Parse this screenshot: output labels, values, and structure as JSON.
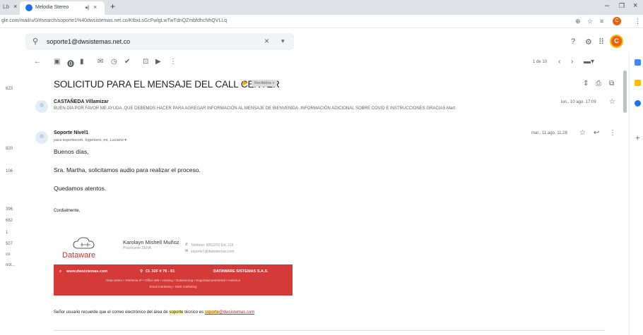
{
  "browser": {
    "prev_tab_fragment": "Lb",
    "tab_title": "Melodia Stereo",
    "url_prefix": "gle.com/mail/u/0/#search/soporte1%40dwsistemas.net.co/KtbxLsGcFwlgLwTwTdnQZmbfdhcNhQVLLq",
    "profile_letter": "C"
  },
  "gmail": {
    "search_value": "soporte1@dwsistemas.net.co",
    "avatar_letter": "C",
    "pager": "1 de 10",
    "left_counts": [
      "623",
      "820",
      "106",
      "396",
      "682",
      "1",
      "507",
      "co",
      "not..."
    ]
  },
  "thread": {
    "subject": "SOLICITUD PARA EL MENSAJE DEL CALL CENTER",
    "label": "Recibidos x",
    "messages": [
      {
        "sender": "CASTAÑEDA Villamizar",
        "snippet": "BUEN DIA POR FAVOR ME AYUDA .QUE DEBEMOS HACER PARA AGREGAR INFORMACIÓN AL MENSAJE DE BIENVENIDA .INFORMACIÓN ADICIONAL SOBRE COVID E INSTRUCCIONES GRACIAS Mart",
        "date": "lun., 10 ago. 17:09"
      },
      {
        "sender": "Soporte Nivel1",
        "recipients": "para soportecom, Ingeniero, mí, Luciano ▾",
        "date": "mar., 11 ago. 11:28",
        "body": [
          "Buenos días,",
          "Sra. Martha, solicitamos audio para realizar el proceso.",
          "Quedamos atentos."
        ],
        "closing": "Cordialmente,"
      }
    ]
  },
  "signature": {
    "brand": "Dataware",
    "name": "Karolayn Mishell Muñoz",
    "role": "Practicante SENA",
    "phone": "Teléfono: 6052203 Ext. 116",
    "email": "soporte1@dwsistemas.com",
    "banner_web": "www.dwsistemas.com",
    "banner_address": "Cl. 32F # 76 - 61",
    "banner_company": "DATAWARE SISTEMAS S.A.S.",
    "banner_services_1": "Data center • Telefonía IP • Office 365 • Hosting • Outsourcing • Seguridad perimetral • Antivirus",
    "banner_services_2": "Email marketing • SMS marketing"
  },
  "footer": {
    "pre": "Señor usuario recuerde que el correo electrónico del área de ",
    "highlight": "soporte",
    "mid": " técnico es ",
    "link_hl": "soporte",
    "link_rest": "@dwsistemas.com"
  },
  "colors": {
    "accent": "#1a73e8",
    "brand_red": "#d43a37",
    "label_orange": "#f2a600"
  }
}
